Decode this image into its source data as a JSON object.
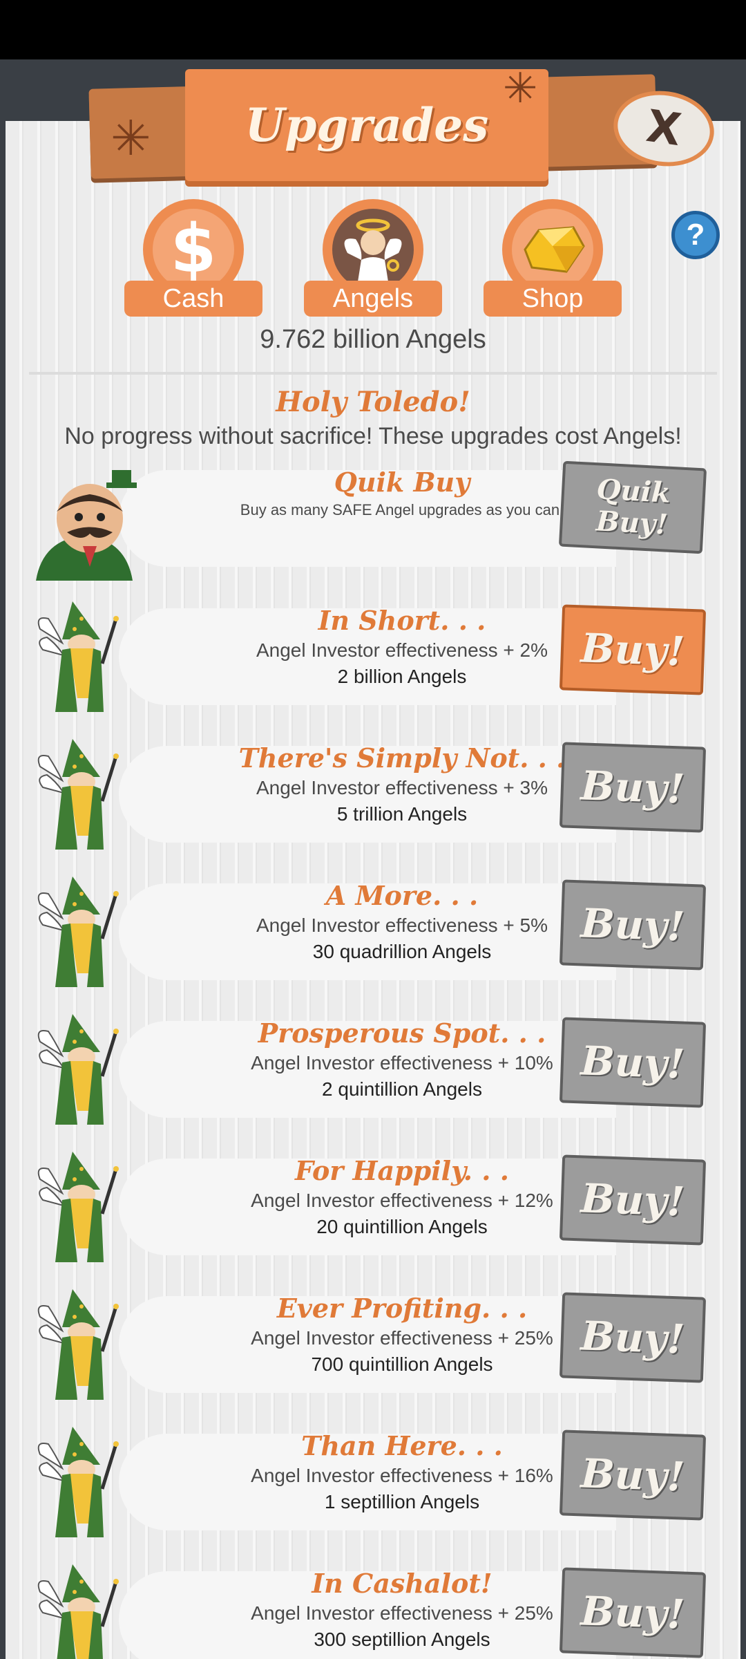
{
  "header": {
    "title": "Upgrades",
    "close_label": "X"
  },
  "tabs": [
    {
      "label": "Cash",
      "icon": "dollar-icon"
    },
    {
      "label": "Angels",
      "icon": "angel-icon"
    },
    {
      "label": "Shop",
      "icon": "gold-gem-icon"
    }
  ],
  "help_label": "?",
  "balance": "9.762 billion Angels",
  "section": {
    "title": "Holy Toledo!",
    "subtitle": "No progress without sacrifice! These upgrades cost Angels!"
  },
  "quik_buy": {
    "title": "Quik Buy",
    "description": "Buy as many SAFE Angel upgrades as you can.",
    "button_label": "Quik Buy!"
  },
  "upgrades": [
    {
      "title": "In Short. . .",
      "effect": "Angel Investor effectiveness + 2%",
      "cost": "2 billion Angels",
      "button": "Buy!",
      "affordable": true
    },
    {
      "title": "There's Simply Not. . .",
      "effect": "Angel Investor effectiveness + 3%",
      "cost": "5 trillion Angels",
      "button": "Buy!",
      "affordable": false
    },
    {
      "title": "A More. . .",
      "effect": "Angel Investor effectiveness + 5%",
      "cost": "30 quadrillion Angels",
      "button": "Buy!",
      "affordable": false
    },
    {
      "title": "Prosperous Spot. . .",
      "effect": "Angel Investor effectiveness + 10%",
      "cost": "2 quintillion Angels",
      "button": "Buy!",
      "affordable": false
    },
    {
      "title": "For Happily. . .",
      "effect": "Angel Investor effectiveness + 12%",
      "cost": "20 quintillion Angels",
      "button": "Buy!",
      "affordable": false
    },
    {
      "title": "Ever Profiting. . .",
      "effect": "Angel Investor effectiveness + 25%",
      "cost": "700 quintillion Angels",
      "button": "Buy!",
      "affordable": false
    },
    {
      "title": "Than Here. . .",
      "effect": "Angel Investor effectiveness + 16%",
      "cost": "1 septillion Angels",
      "button": "Buy!",
      "affordable": false
    },
    {
      "title": "In Cashalot!",
      "effect": "Angel Investor effectiveness + 25%",
      "cost": "300 septillion Angels",
      "button": "Buy!",
      "affordable": false
    }
  ],
  "colors": {
    "accent": "#ee8c50",
    "title_orange": "#e07a38",
    "button_disabled": "#9c9c9c",
    "help_blue": "#3d8fd0"
  }
}
